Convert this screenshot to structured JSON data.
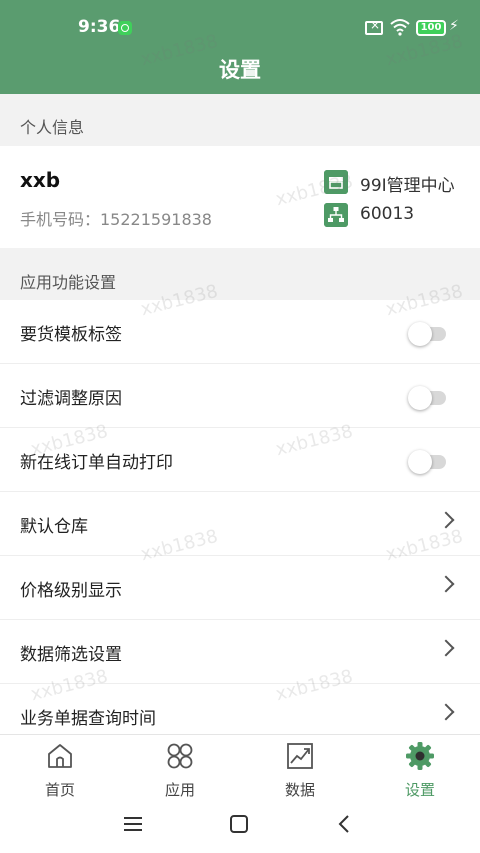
{
  "status_bar": {
    "time": "9:36",
    "battery": "100"
  },
  "header": {
    "title": "设置"
  },
  "personal_section": {
    "title": "个人信息"
  },
  "profile": {
    "username": "xxb",
    "phone_label": "手机号码：15221591838",
    "store": "99I管理中心",
    "org_code": "60013"
  },
  "app_settings_section": {
    "title": "应用功能设置"
  },
  "settings": {
    "items": [
      {
        "label": "要货模板标签",
        "control": "toggle",
        "enabled": false
      },
      {
        "label": "过滤调整原因",
        "control": "toggle",
        "enabled": false
      },
      {
        "label": "新在线订单自动打印",
        "control": "toggle",
        "enabled": false
      },
      {
        "label": "默认仓库",
        "control": "chevron"
      },
      {
        "label": "价格级别显示",
        "control": "chevron"
      },
      {
        "label": "数据筛选设置",
        "control": "chevron"
      },
      {
        "label": "业务单据查询时间",
        "control": "chevron"
      }
    ]
  },
  "tabs": [
    {
      "label": "首页",
      "icon": "home-icon",
      "active": false
    },
    {
      "label": "应用",
      "icon": "apps-icon",
      "active": false
    },
    {
      "label": "数据",
      "icon": "chart-icon",
      "active": false
    },
    {
      "label": "设置",
      "icon": "gear-icon",
      "active": true
    }
  ],
  "watermark": "xxb1838",
  "colors": {
    "primary": "#5a9c6f",
    "accent": "#4e9a65",
    "background": "#f2f2f2"
  }
}
